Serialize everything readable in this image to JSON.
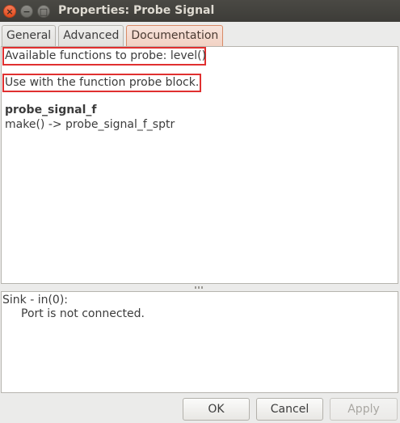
{
  "window": {
    "title": "Properties: Probe Signal",
    "controls": {
      "close": "×",
      "minimize": "−",
      "maximize": "□"
    }
  },
  "tabs": [
    {
      "label": "General"
    },
    {
      "label": "Advanced"
    },
    {
      "label": "Documentation"
    }
  ],
  "documentation": {
    "line1": "Available functions to probe: level()",
    "line2": "Use with the function probe block.",
    "block_name": "probe_signal_f",
    "signature": "make() -> probe_signal_f_sptr"
  },
  "messages": {
    "port_label": "Sink - in(0):",
    "port_status": "Port is not connected."
  },
  "buttons": {
    "ok": "OK",
    "cancel": "Cancel",
    "apply": "Apply"
  },
  "colors": {
    "highlight_box": "#e03030",
    "active_tab": "#f2d2c4"
  }
}
